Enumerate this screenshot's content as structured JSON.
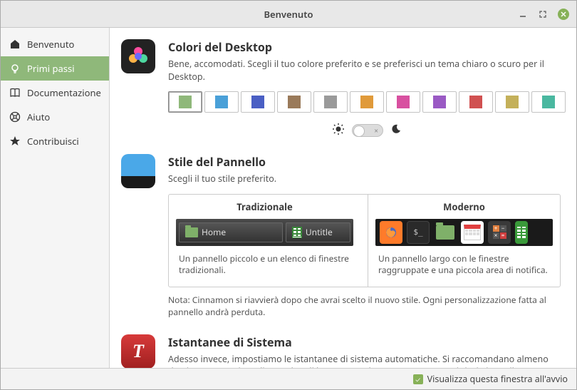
{
  "window": {
    "title": "Benvenuto"
  },
  "sidebar": {
    "items": [
      {
        "label": "Benvenuto"
      },
      {
        "label": "Primi passi"
      },
      {
        "label": "Documentazione"
      },
      {
        "label": "Aiuto"
      },
      {
        "label": "Contribuisci"
      }
    ]
  },
  "desktop_colors": {
    "title": "Colori del Desktop",
    "desc": "Bene, accomodati. Scegli il tuo colore preferito e se preferisci un tema chiaro o scuro per il Desktop.",
    "colors": [
      "#8fb87a",
      "#4aa0d8",
      "#4a5fc4",
      "#9a7a5a",
      "#9a9a9a",
      "#e09a3a",
      "#d850a0",
      "#9a5ac4",
      "#d05050",
      "#c4b05a",
      "#4ab8a0"
    ],
    "selected_index": 0
  },
  "panel_style": {
    "title": "Stile del Pannello",
    "desc": "Scegli il tuo stile preferito.",
    "traditional": {
      "header": "Tradizionale",
      "preview_home": "Home",
      "preview_untitled": "Untitle",
      "desc": "Un pannello piccolo e un elenco di finestre tradizionali."
    },
    "modern": {
      "header": "Moderno",
      "desc": "Un pannello largo con le finestre raggruppate e una piccola area di notifica."
    },
    "note": "Nota: Cinnamon si riavvierà dopo che avrai scelto il nuovo stile. Ogni personalizzazione fatta al pannello andrà perduta."
  },
  "snapshots": {
    "title": "Istantanee di Sistema",
    "desc": "Adesso invece, impostiamo le istantanee di sistema automatiche. Si raccomandano almeno due istantanee giornaliere e due di boot. Se qualcosa va storto, potrai ripristinare il tuo"
  },
  "footer": {
    "show_on_startup": "Visualizza questa finestra all'avvio"
  }
}
